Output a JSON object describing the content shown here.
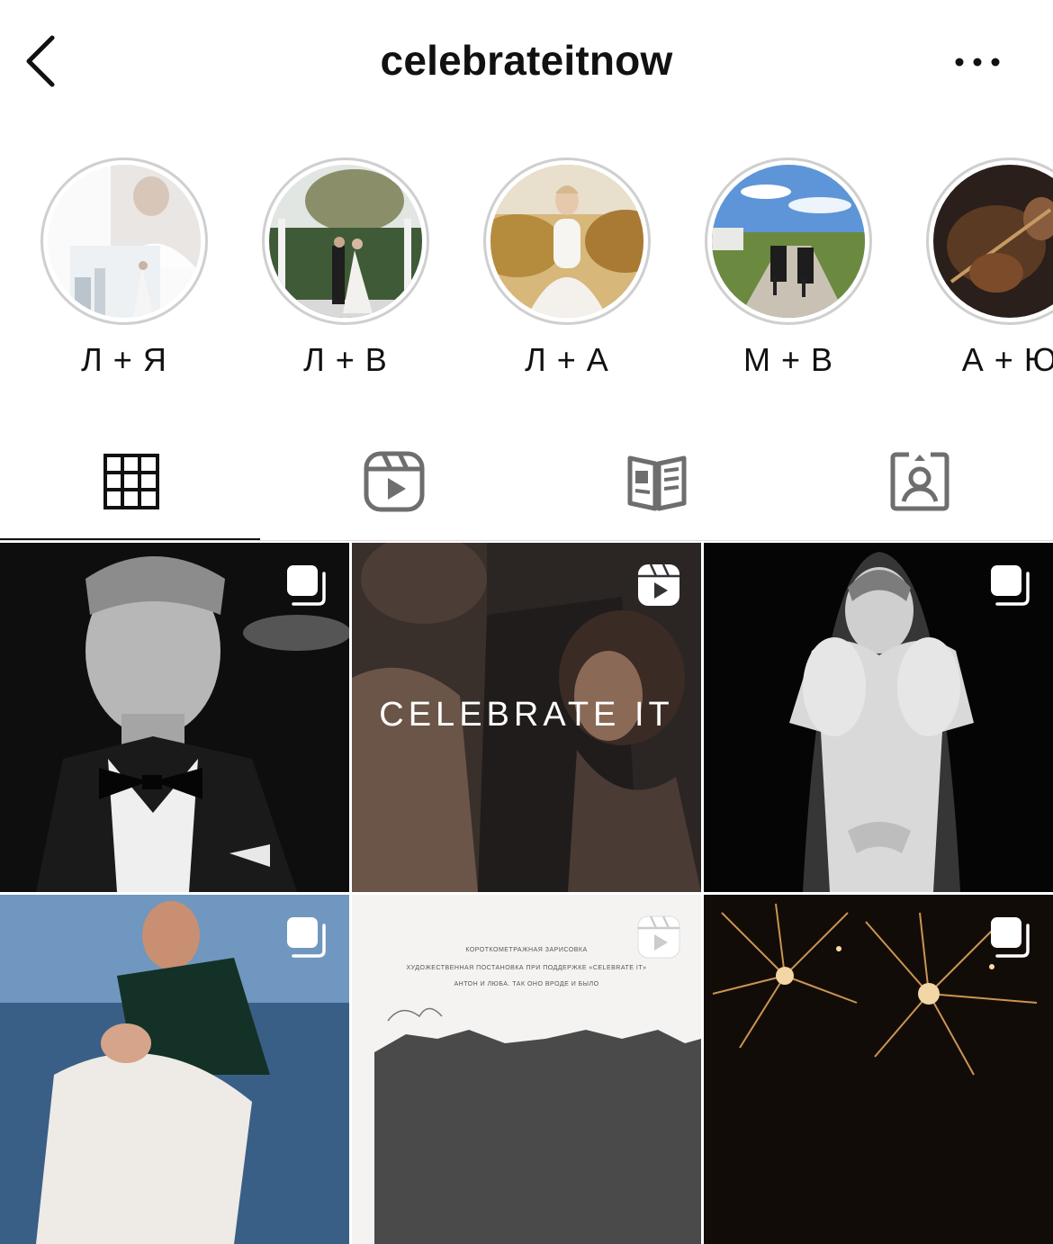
{
  "header": {
    "username": "celebrateitnow",
    "back_icon": "chevron-left-icon",
    "more_icon": "ellipsis-icon"
  },
  "highlights": [
    {
      "label": "Л + Я"
    },
    {
      "label": "Л + В"
    },
    {
      "label": "Л + А"
    },
    {
      "label": "М + В"
    },
    {
      "label": "А + Ю"
    }
  ],
  "tabs": [
    {
      "icon": "grid-icon",
      "active": true
    },
    {
      "icon": "reels-icon",
      "active": false
    },
    {
      "icon": "guides-icon",
      "active": false
    },
    {
      "icon": "tagged-icon",
      "active": false
    }
  ],
  "posts": [
    {
      "badge": "carousel-icon"
    },
    {
      "badge": "reel-icon",
      "overlay_text": "CELEBRATE IT"
    },
    {
      "badge": "carousel-icon"
    },
    {
      "badge": "carousel-icon"
    },
    {
      "badge": "reel-icon",
      "doc_lines": [
        "КОРОТКОМЕТРАЖНАЯ ЗАРИСОВКА",
        "ХУДОЖЕСТВЕННАЯ ПОСТАНОВКА ПРИ ПОДДЕРЖКЕ «CELEBRATE IT»",
        "АНТОН И ЛЮБА. ТАК ОНО ВРОДЕ И БЫЛО"
      ]
    },
    {
      "badge": "carousel-icon"
    }
  ],
  "colors": {
    "text": "#111111",
    "icon_gray": "#6e6e6e",
    "ring": "#cfcfcf",
    "divider": "#dbdbdb"
  }
}
